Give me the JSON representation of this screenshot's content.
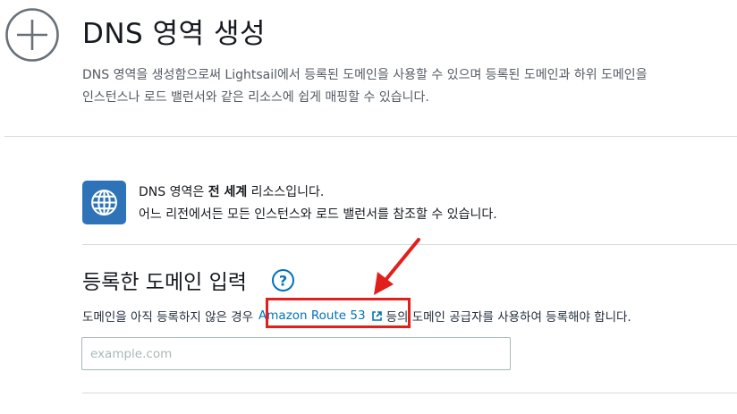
{
  "header": {
    "title": "DNS 영역 생성",
    "description": "DNS 영역을 생성함으로써 Lightsail에서 등록된 도메인을 사용할 수 있으며 등록된 도메인과 하위 도메인을 인스턴스나 로드 밸런서와 같은 리소스에 쉽게 매핑할 수 있습니다."
  },
  "info": {
    "line1_prefix": "DNS 영역은 ",
    "line1_bold": "전 세계",
    "line1_suffix": " 리소스입니다.",
    "line2": "어느 리전에서든 모든 인스턴스와 로드 밸런서를 참조할 수 있습니다."
  },
  "domain_section": {
    "heading": "등록한 도메인 입력",
    "help_before": "도메인을 아직 등록하지 않은 경우",
    "link_label": "Amazon Route 53",
    "help_after": "등의 도메인 공급자를 사용하여 등록해야 합니다.",
    "input_value": "",
    "input_placeholder": "example.com"
  },
  "icons": {
    "create": "plus-circle-icon",
    "globe": "globe-icon",
    "help": "question-circle-icon",
    "external": "external-link-icon",
    "annotation": "red-arrow"
  },
  "colors": {
    "link": "#0073bb",
    "accent": "#2e73b8",
    "highlight": "#e0201c"
  }
}
